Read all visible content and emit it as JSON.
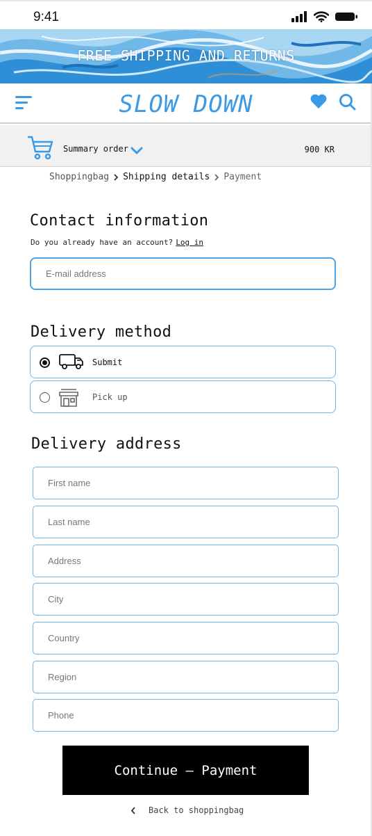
{
  "status_bar": {
    "time": "9:41"
  },
  "banner": {
    "text": "FREE SHIPPING AND RETURNS"
  },
  "header": {
    "brand": "SLOW DOWN",
    "menu_icon": "hamburger-menu-icon",
    "favorites_icon": "heart-icon",
    "search_icon": "search-icon",
    "accent_color": "#3a9ae6"
  },
  "summary": {
    "label": "Summary order",
    "total": "900 KR",
    "cart_icon": "shopping-cart-icon"
  },
  "breadcrumb": {
    "step1": "Shoppingbag",
    "step2": "Shipping details",
    "step3": "Payment"
  },
  "contact": {
    "title": "Contact information",
    "account_prompt": "Do you already have an account?",
    "login_link": "Log in",
    "email_placeholder": "E-mail address"
  },
  "delivery": {
    "title": "Delivery method",
    "options": [
      {
        "label": "Submit",
        "icon": "delivery-truck-icon",
        "selected": true
      },
      {
        "label": "Pick up",
        "icon": "store-icon",
        "selected": false
      }
    ]
  },
  "address": {
    "title": "Delivery address",
    "fields": [
      "First name",
      "Last name",
      "Address",
      "City",
      "Country",
      "Region",
      "Phone"
    ]
  },
  "actions": {
    "continue_label": "Continue — Payment",
    "back_label": "Back to shoppingbag"
  }
}
